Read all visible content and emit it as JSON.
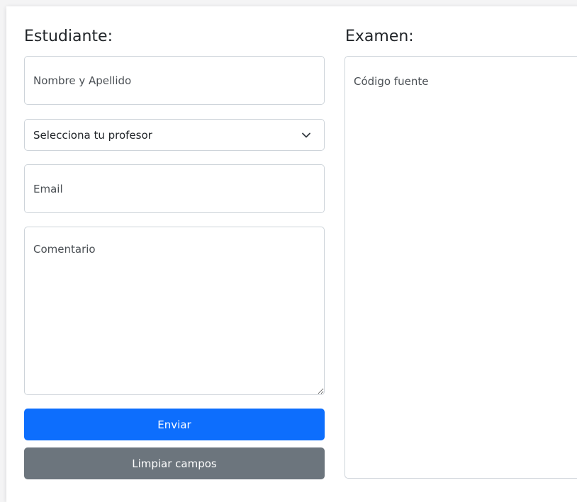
{
  "student": {
    "heading": "Estudiante:",
    "name_placeholder": "Nombre y Apellido",
    "teacher_select": {
      "selected": "Selecciona tu profesor",
      "icon": "chevron-down-icon"
    },
    "email_placeholder": "Email",
    "comment_placeholder": "Comentario"
  },
  "exam": {
    "heading": "Examen:",
    "code_placeholder": "Código fuente"
  },
  "actions": {
    "submit_label": "Enviar",
    "clear_label": "Limpiar campos"
  },
  "colors": {
    "primary": "#0d6efd",
    "secondary": "#6c757d",
    "border": "#ced4da"
  }
}
